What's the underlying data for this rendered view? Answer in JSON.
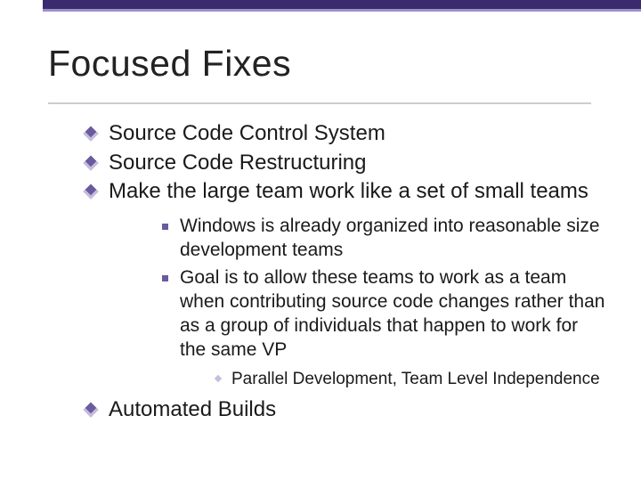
{
  "title": "Focused Fixes",
  "bullets": {
    "b0": "Source Code Control System",
    "b1": "Source Code Restructuring",
    "b2": "Make the large team work like a set of small teams",
    "b3": "Automated Builds"
  },
  "sub": {
    "s0": "Windows is already organized into reasonable size development teams",
    "s1": "Goal is to allow these teams to work as a team when contributing source code changes rather than as a group of individuals that happen to work for the same VP"
  },
  "subsub": {
    "t0": "Parallel Development, Team Level Independence"
  }
}
